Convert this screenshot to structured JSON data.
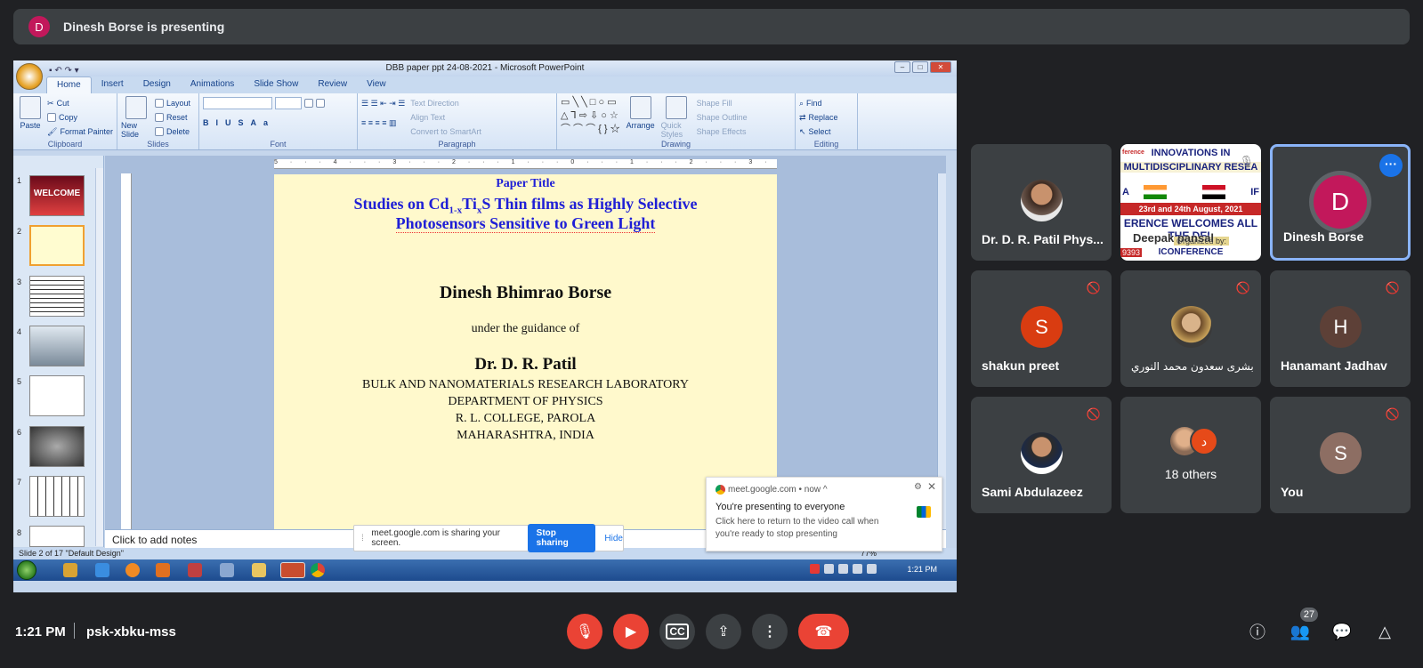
{
  "top_bar": {
    "avatar_letter": "D",
    "presenting_text": "Dinesh Borse is presenting"
  },
  "ppt": {
    "window_title": "DBB  paper ppt      24-08-2021 - Microsoft PowerPoint",
    "tabs": [
      "Home",
      "Insert",
      "Design",
      "Animations",
      "Slide Show",
      "Review",
      "View"
    ],
    "ribbon": {
      "clipboard": {
        "paste": "Paste",
        "cut": "Cut",
        "copy": "Copy",
        "format_painter": "Format Painter",
        "label": "Clipboard"
      },
      "slides": {
        "new_slide": "New Slide",
        "layout": "Layout",
        "reset": "Reset",
        "delete": "Delete",
        "label": "Slides"
      },
      "font": {
        "label": "Font"
      },
      "paragraph": {
        "text_direction": "Text Direction",
        "align_text": "Align Text",
        "convert": "Convert to SmartArt",
        "label": "Paragraph"
      },
      "drawing": {
        "arrange": "Arrange",
        "quick_styles": "Quick Styles",
        "shape_fill": "Shape Fill",
        "shape_outline": "Shape Outline",
        "shape_effects": "Shape Effects",
        "label": "Drawing"
      },
      "editing": {
        "find": "Find",
        "replace": "Replace",
        "select": "Select",
        "label": "Editing"
      }
    },
    "slide_numbers": [
      "1",
      "2",
      "3",
      "4",
      "5",
      "6",
      "7",
      "8"
    ],
    "thumb1_text": "WELCOME",
    "ruler_text": "5 · · · 4 · · · 3 · · · 2 · · · 1 · · · 0 · · · 1 · · · 2 · · · 3 · · · 4 · · · 5",
    "slide": {
      "kicker": "Paper Title",
      "title_line1": {
        "pre": "Studies on Cd",
        "sub1": "1-x",
        "mid": "Ti",
        "sub2": "x",
        "post": "S Thin films as Highly Selective"
      },
      "title_line2": "Photosensors Sensitive to Green Light",
      "author": "Dinesh Bhimrao Borse",
      "guidance": "under the guidance of",
      "guide": "Dr. D. R. Patil",
      "lines": [
        "BULK AND NANOMATERIALS RESEARCH LABORATORY",
        "DEPARTMENT OF PHYSICS",
        "R. L. COLLEGE, PAROLA",
        "MAHARASHTRA, INDIA"
      ]
    },
    "notes_placeholder": "Click to add notes",
    "status": "Slide 2 of 17    \"Default Design\"",
    "zoom": "77%",
    "taskbar_time": "1:21 PM"
  },
  "share_bar": {
    "text": "meet.google.com is sharing your screen.",
    "stop": "Stop sharing",
    "hide": "Hide"
  },
  "notification": {
    "source": "meet.google.com  •  now ^",
    "title": "You're presenting to everyone",
    "body": "Click here to return to the video call when you're ready to stop presenting"
  },
  "tiles": [
    {
      "name": "Dr. D. R. Patil Phys..."
    },
    {
      "name": "Deepak pansal",
      "banner": {
        "line1": "INNOVATIONS IN",
        "line2": "MULTIDISCIPLINARY RESEA",
        "line3": "ERENCE WELCOMES ALL THE DEL",
        "line4": "23rd and 24th August, 2021",
        "line5": "ICONFERENCE",
        "left_code": "A",
        "right_code": "IF",
        "code": "9393",
        "organized": "Organized by:",
        "ribbon": "ference"
      }
    },
    {
      "name": "Dinesh Borse",
      "letter": "D"
    },
    {
      "name": "shakun preet",
      "letter": "S",
      "color": "#d93c11"
    },
    {
      "name": "بشرى سعدون محمد النوري"
    },
    {
      "name": "Hanamant Jadhav",
      "letter": "H",
      "color": "#5d4037"
    },
    {
      "name": "Sami Abdulazeez"
    },
    {
      "name": "18 others",
      "letter": "د"
    },
    {
      "name": "You",
      "letter": "S",
      "color": "#8d6e63"
    }
  ],
  "bottom": {
    "time": "1:21 PM",
    "meeting_code": "psk-xbku-mss",
    "participants_count": "27"
  }
}
